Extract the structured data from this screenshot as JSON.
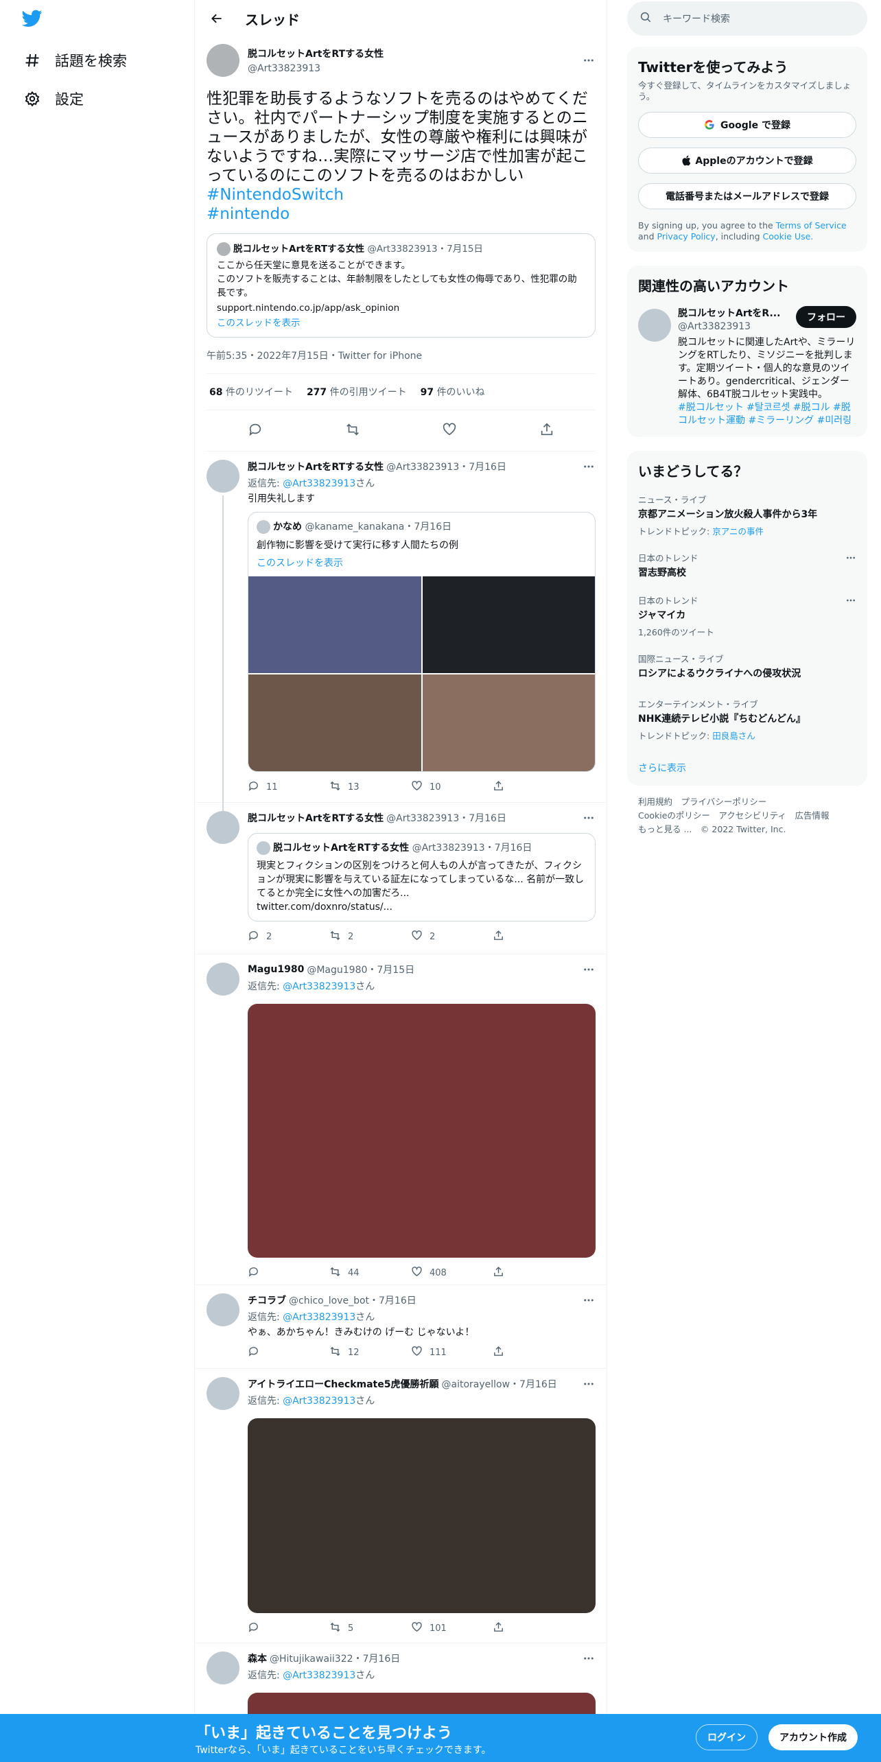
{
  "nav": {
    "explore_label": "話題を検索",
    "settings_label": "設定"
  },
  "header": {
    "title": "スレッド"
  },
  "focal": {
    "name": "脱コルセットArtをRTする女性",
    "handle": "@Art33823913",
    "text": "性犯罪を助長するようなソフトを売るのはやめてください。社内でパートナーシップ制度を実施するとのニュースがありましたが、女性の尊厳や権利には興味がないようですね…実際にマッサージ店で性加害が起こっているのにこのソフトを売るのはおかしい",
    "tag1": "#NintendoSwitch",
    "tag2": "#nintendo",
    "quote": {
      "name": "脱コルセットArtをRTする女性",
      "handle_date": "@Art33823913・7月15日",
      "line1": "ここから任天堂に意見を送ることができます。",
      "line2": "このソフトを販売することは、年齢制限をしたとしても女性の侮辱であり、性犯罪の助長です。",
      "line3": "support.nintendo.co.jp/app/ask_opinion",
      "show_thread": "このスレッドを表示"
    },
    "meta": "午前5:35・2022年7月15日・Twitter for iPhone",
    "retweets_n": "68",
    "retweets_l": "件のリツイート",
    "quotes_n": "277",
    "quotes_l": "件の引用ツイート",
    "likes_n": "97",
    "likes_l": "件のいいね"
  },
  "replies": [
    {
      "name": "脱コルセットArtをRTする女性",
      "meta": "@Art33823913・7月16日",
      "reply_prefix": "返信先: ",
      "reply_to": "@Art33823913",
      "reply_suffix": "さん",
      "text": "引用失礼します",
      "quote_name": "かなめ",
      "quote_meta": "@kaname_kanakana・7月16日",
      "quote_text": "創作物に影響を受けて実行に移す人間たちの例",
      "quote_link": "このスレッドを表示",
      "replies": "11",
      "retweets": "13",
      "likes": "10"
    },
    {
      "name": "脱コルセットArtをRTする女性",
      "meta": "@Art33823913・7月16日",
      "quote_name": "脱コルセットArtをRTする女性",
      "quote_meta": "@Art33823913・7月16日",
      "quote_text": "現実とフィクションの区別をつけろと何人もの人が言ってきたが、フィクションが現実に影響を与えている証左になってしまっているな... 名前が一致してるとか完全に女性への加害だろ...",
      "quote_url": "twitter.com/doxnro/status/...",
      "replies": "2",
      "retweets": "2",
      "likes": "2"
    },
    {
      "name": "Magu1980",
      "meta": "@Magu1980・7月15日",
      "reply_prefix": "返信先: ",
      "reply_to": "@Art33823913",
      "reply_suffix": "さん",
      "retweets": "44",
      "likes": "408"
    },
    {
      "name": "チコラブ",
      "meta": "@chico_love_bot・7月16日",
      "reply_prefix": "返信先: ",
      "reply_to": "@Art33823913",
      "reply_suffix": "さん",
      "text": "やぁ、あかちゃん！きみむけの げーむ じゃないよ！",
      "retweets": "12",
      "likes": "111"
    },
    {
      "name": "アイトライエローCheckmate5虎優勝祈願",
      "meta": "@aitorayellow・7月16日",
      "reply_prefix": "返信先: ",
      "reply_to": "@Art33823913",
      "reply_suffix": "さん",
      "retweets": "5",
      "likes": "101"
    },
    {
      "name": "森本",
      "meta": "@Hitujikawaii322・7月16日",
      "reply_prefix": "返信先: ",
      "reply_to": "@Art33823913",
      "reply_suffix": "さん"
    }
  ],
  "right": {
    "search_placeholder": "キーワード検索",
    "signup_title": "Twitterを使ってみよう",
    "signup_sub": "今すぐ登録して、タイムラインをカスタマイズしましょう。",
    "google_btn": "Google で登録",
    "apple_btn": "Appleのアカウントで登録",
    "phone_btn": "電話番号またはメールアドレスで登録",
    "terms_1": "By signing up, you agree to the ",
    "terms_tos": "Terms of Service",
    "terms_2": " and ",
    "terms_pp": "Privacy Policy",
    "terms_3": ", including ",
    "terms_cu": "Cookie Use.",
    "related_title": "関連性の高いアカウント",
    "acct_name": "脱コルセットArtをR...",
    "acct_handle": "@Art33823913",
    "follow_btn": "フォロー",
    "acct_bio": "脱コルセットに関連したArtや、ミラーリングをRTしたり、ミソジニーを批判します。定期ツイート・個人的な意見のツイートあり。gendercritical、ジェンダー解体、6B4T脱コルセット実践中。",
    "acct_tags": "#脱コルセット #탈코르셋 #脱コル #脱コルセット運動 #ミラーリング #미러링",
    "trends_title": "いまどうしてる？",
    "trends": [
      {
        "cat": "ニュース・ライブ",
        "name": "京都アニメーション放火殺人事件から3年",
        "extra_pre": "トレンドトピック: ",
        "extra_link": "京アニの事件"
      },
      {
        "cat": "日本のトレンド",
        "name": "習志野高校"
      },
      {
        "cat": "日本のトレンド",
        "name": "ジャマイカ",
        "extra_pre": "1,260件のツイート"
      },
      {
        "cat": "国際ニュース・ライブ",
        "name": "ロシアによるウクライナへの侵攻状況"
      },
      {
        "cat": "エンターテインメント・ライブ",
        "name": "NHK連続テレビ小説『ちむどんどん』",
        "extra_pre": "トレンドトピック: ",
        "extra_link": "田良島さん"
      }
    ],
    "show_more": "さらに表示",
    "footer_1": "利用規約　プライバシーポリシー",
    "footer_2": "Cookieのポリシー　アクセシビリティ　広告情報",
    "footer_3": "もっと見る ...　© 2022 Twitter, Inc."
  },
  "banner": {
    "title": "「いま」起きていることを見つけよう",
    "sub": "Twitterなら、「いま」起きていることをいち早くチェックできます。",
    "login": "ログイン",
    "signup": "アカウント作成"
  },
  "colors": {
    "accent": "#1d9bf0",
    "text": "#0f1419",
    "muted": "#536471"
  }
}
